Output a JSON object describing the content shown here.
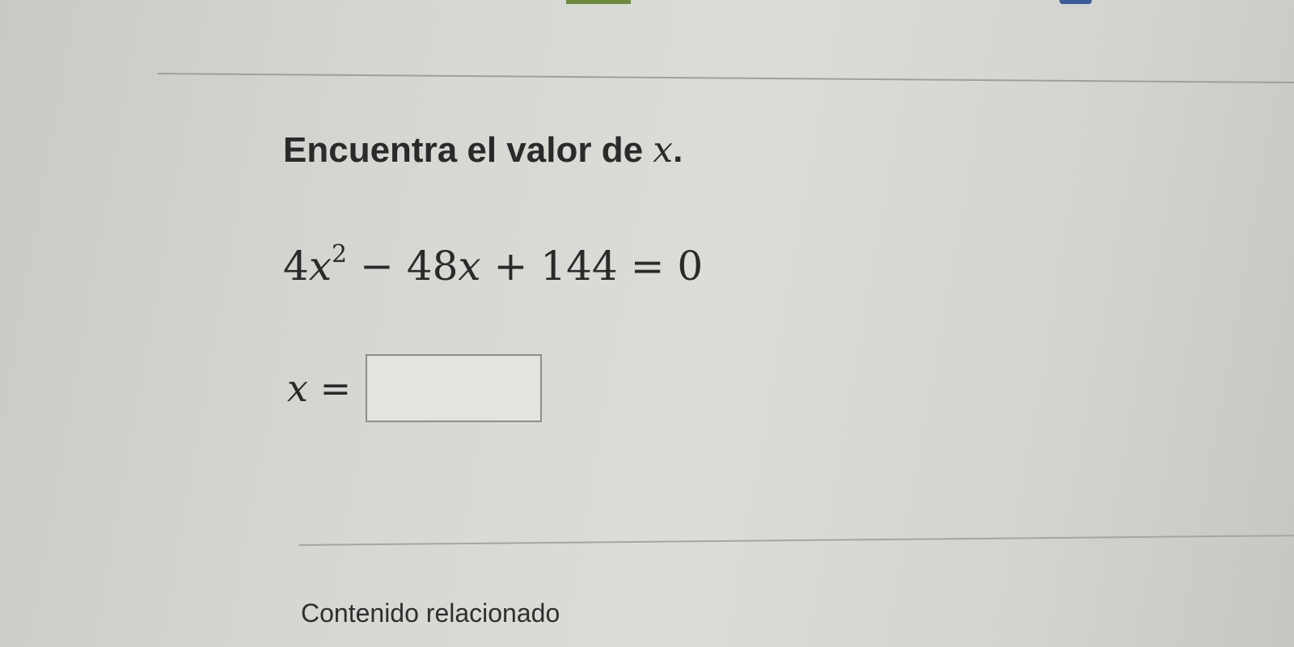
{
  "question": {
    "prefix": "Encuentra el valor de ",
    "variable": "x",
    "suffix": "."
  },
  "equation": {
    "coef": "4",
    "var": "x",
    "exp": "2",
    "middle": " − 48",
    "var2": "x",
    "tail": " + 144 = 0"
  },
  "answer": {
    "label": "x =",
    "value": ""
  },
  "related": {
    "title": "Contenido relacionado"
  },
  "colors": {
    "text": "#2a2a2a",
    "accent_green": "#6d8a3f",
    "accent_blue": "#3b5c98"
  }
}
